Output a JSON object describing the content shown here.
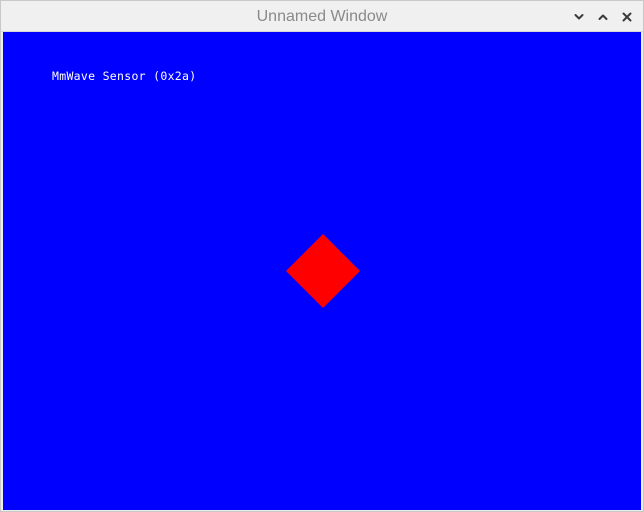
{
  "window": {
    "title": "Unnamed Window",
    "controls": [
      "minimize",
      "maximize",
      "close"
    ]
  },
  "canvas": {
    "background_color": "#0000ff",
    "label": "MmWave Sensor (0x2a)",
    "label_color": "#ffffff",
    "marker": {
      "shape": "diamond",
      "color": "#ff0000"
    }
  }
}
